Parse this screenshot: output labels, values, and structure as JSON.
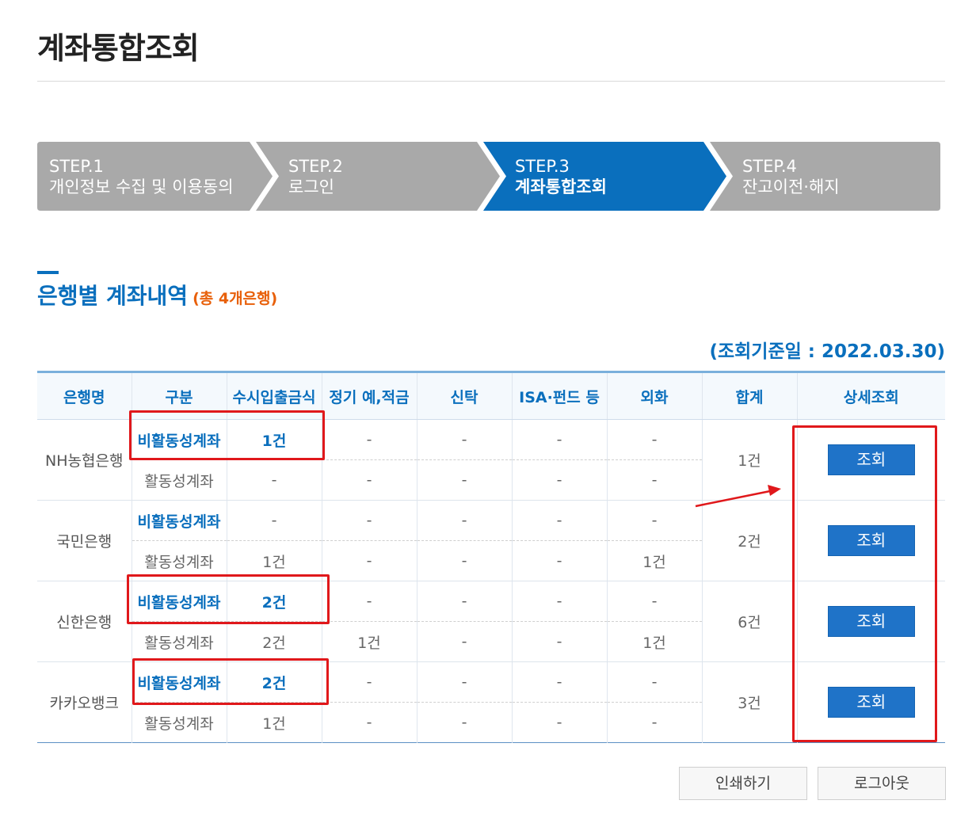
{
  "page": {
    "title": "계좌통합조회"
  },
  "steps": [
    {
      "num": "STEP.1",
      "label": "개인정보 수집 및 이용동의",
      "active": false
    },
    {
      "num": "STEP.2",
      "label": "로그인",
      "active": false
    },
    {
      "num": "STEP.3",
      "label": "계좌통합조회",
      "active": true
    },
    {
      "num": "STEP.4",
      "label": "잔고이전·해지",
      "active": false
    }
  ],
  "colors": {
    "step_active": "#0a6fbd",
    "step_inactive": "#a9a9a9",
    "accent": "#0a6fbd",
    "count_orange": "#e8600a",
    "annotation_red": "#e0181b"
  },
  "section": {
    "title": "은행별 계좌내역",
    "count": "(총 4개은행)",
    "as_of": "(조회기준일 : 2022.03.30)"
  },
  "table": {
    "headers": [
      "은행명",
      "구분",
      "수시입출금식",
      "정기 예,적금",
      "신탁",
      "ISA·펀드 등",
      "외화",
      "합계",
      "상세조회"
    ],
    "banks": [
      {
        "name": "NH농협은행",
        "total": "1건",
        "button": "조회",
        "rows": [
          {
            "type": "비활동성계좌",
            "cells": [
              "1건",
              "-",
              "-",
              "-",
              "-"
            ]
          },
          {
            "type": "활동성계좌",
            "cells": [
              "-",
              "-",
              "-",
              "-",
              "-"
            ]
          }
        ]
      },
      {
        "name": "국민은행",
        "total": "2건",
        "button": "조회",
        "rows": [
          {
            "type": "비활동성계좌",
            "cells": [
              "-",
              "-",
              "-",
              "-",
              "-"
            ]
          },
          {
            "type": "활동성계좌",
            "cells": [
              "1건",
              "-",
              "-",
              "-",
              "1건"
            ]
          }
        ]
      },
      {
        "name": "신한은행",
        "total": "6건",
        "button": "조회",
        "rows": [
          {
            "type": "비활동성계좌",
            "cells": [
              "2건",
              "-",
              "-",
              "-",
              "-"
            ]
          },
          {
            "type": "활동성계좌",
            "cells": [
              "2건",
              "1건",
              "-",
              "-",
              "1건"
            ]
          }
        ]
      },
      {
        "name": "카카오뱅크",
        "total": "3건",
        "button": "조회",
        "rows": [
          {
            "type": "비활동성계좌",
            "cells": [
              "2건",
              "-",
              "-",
              "-",
              "-"
            ]
          },
          {
            "type": "활동성계좌",
            "cells": [
              "1건",
              "-",
              "-",
              "-",
              "-"
            ]
          }
        ]
      }
    ]
  },
  "buttons": {
    "print": "인쇄하기",
    "logout": "로그아웃"
  }
}
